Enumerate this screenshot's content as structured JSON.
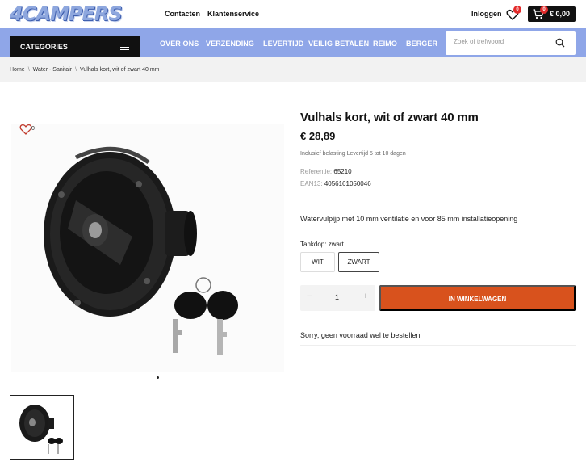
{
  "header": {
    "logo_text": "4CAMPERS",
    "links": [
      "Contacten",
      "Klantenservice"
    ],
    "login_label": "Inloggen",
    "wishlist_count": "0",
    "cart_count": "0",
    "cart_total": "€ 0,00"
  },
  "nav": {
    "categories_label": "CATEGORIES",
    "links": [
      "OVER ONS",
      "VERZENDING",
      "LEVERTIJD",
      "VEILIG BETALEN",
      "REIMO",
      "BERGER"
    ],
    "search_placeholder": "Zoek of trefwoord"
  },
  "breadcrumb": [
    "Home",
    "Water - Sanitair",
    "Vulhals kort, wit of zwart 40 mm"
  ],
  "gallery": {
    "wishlist_count": "0"
  },
  "product": {
    "title": "Vulhals kort, wit of zwart 40 mm",
    "price": "€ 28,89",
    "tax_note": "Inclusief belasting Levertijd 5 tot 10 dagen",
    "reference_label": "Referentie:",
    "reference_value": "65210",
    "ean_label": "EAN13:",
    "ean_value": "4056161050046",
    "description": "Watervulpijp met 10 mm ventilatie en voor 85 mm installatieopening",
    "option_label": "Tankdop: zwart",
    "options": [
      "WIT",
      "ZWART"
    ],
    "selected_option": "ZWART",
    "quantity": "1",
    "qty_minus": "−",
    "qty_plus": "+",
    "add_to_cart": "IN WINKELWAGEN",
    "stock_note": "Sorry, geen voorraad wel te bestellen"
  },
  "colors": {
    "nav_bg": "#8fa6e8",
    "accent_orange": "#d8521d",
    "badge_red": "#e32b2b",
    "dark": "#111111"
  }
}
